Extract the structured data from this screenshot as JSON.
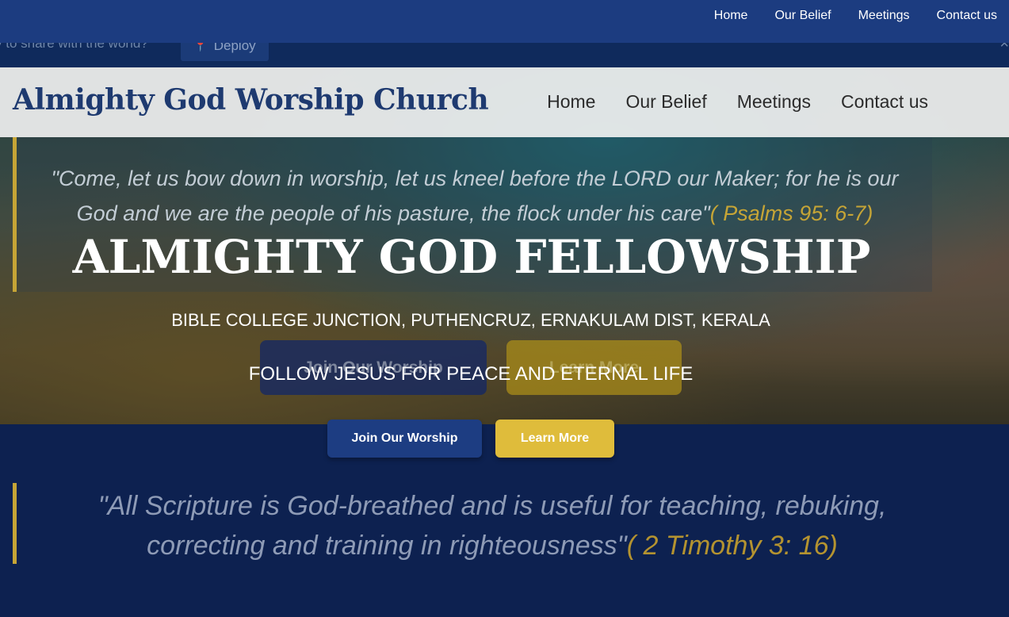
{
  "top_nav": {
    "items": [
      {
        "label": "Home"
      },
      {
        "label": "Our Belief"
      },
      {
        "label": "Meetings"
      },
      {
        "label": "Contact us"
      }
    ]
  },
  "banner": {
    "text": "y to share with the world?",
    "deploy_label": "Deploy",
    "deploy_icon": "pin-icon",
    "close_glyph": "×"
  },
  "site_nav": {
    "brand": "Almighty God Worship Church",
    "items": [
      {
        "label": "Home"
      },
      {
        "label": "Our Belief"
      },
      {
        "label": "Meetings"
      },
      {
        "label": "Contact us"
      }
    ]
  },
  "hero": {
    "quote": "\"Come, let us bow down in worship, let us kneel before the LORD our Maker; for he is our God and we are the people of his pasture, the flock under his care\"",
    "quote_ref": "( Psalms 95: 6-7)",
    "title": "ALMIGHTY GOD FELLOWSHIP",
    "address": "BIBLE COLLEGE JUNCTION, PUTHENCRUZ, ERNAKULAM DIST, KERALA",
    "tagline": "FOLLOW JESUS FOR PEACE AND ETERNAL LIFE",
    "ghost_join_label": "Join Our Worship",
    "ghost_learn_label": "Learn More"
  },
  "actions": {
    "join_label": "Join Our Worship",
    "learn_label": "Learn More"
  },
  "scripture": {
    "quote": "\"All Scripture is God-breathed and is useful for teaching, rebuking, correcting and training in righteousness\"",
    "ref": "( 2 Timothy 3: 16)"
  },
  "colors": {
    "nav_blue": "#1c3c80",
    "dark_navy": "#0d2150",
    "gold": "#dfbc3b",
    "brand_blue": "#1e3a70"
  }
}
